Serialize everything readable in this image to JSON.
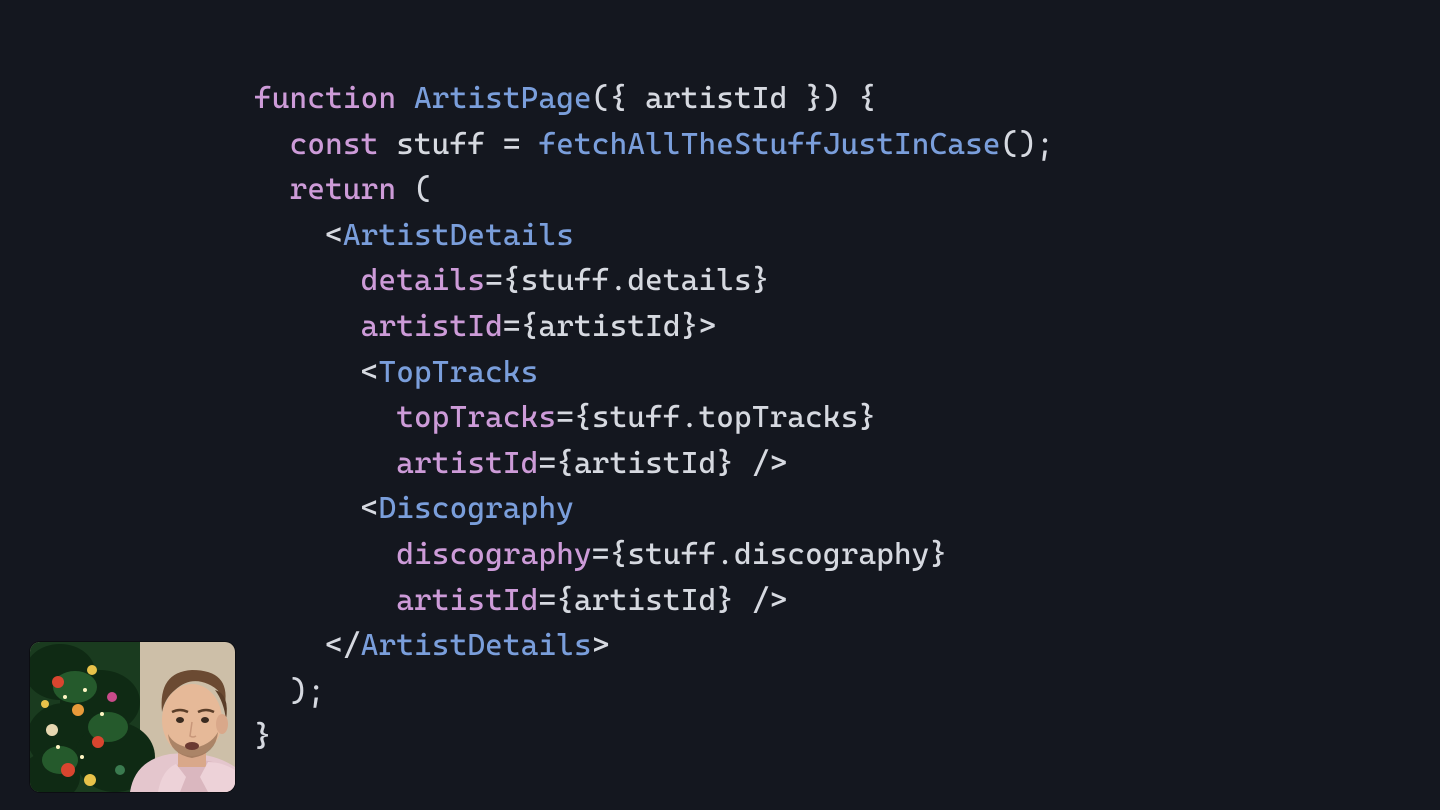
{
  "code": {
    "l1": {
      "kw_function": "function",
      "name": "ArtistPage",
      "params_open": "({ ",
      "param": "artistId",
      "params_close": " }) {"
    },
    "l2": {
      "indent": "  ",
      "kw_const": "const",
      "space": " ",
      "var": "stuff",
      "eq": " = ",
      "call": "fetchAllTheStuffJustInCase",
      "after": "();"
    },
    "l3": {
      "indent": "  ",
      "kw_return": "return",
      "paren": " ("
    },
    "l4": {
      "indent": "    ",
      "open": "<",
      "name": "ArtistDetails"
    },
    "l5": {
      "indent": "      ",
      "attr": "details",
      "eq": "=",
      "brace_o": "{",
      "obj": "stuff",
      "dot": ".",
      "prop": "details",
      "brace_c": "}"
    },
    "l6": {
      "indent": "      ",
      "attr": "artistId",
      "eq": "=",
      "brace_o": "{",
      "val": "artistId",
      "brace_c": "}",
      "close": ">"
    },
    "l7": {
      "indent": "      ",
      "open": "<",
      "name": "TopTracks"
    },
    "l8": {
      "indent": "        ",
      "attr": "topTracks",
      "eq": "=",
      "brace_o": "{",
      "obj": "stuff",
      "dot": ".",
      "prop": "topTracks",
      "brace_c": "}"
    },
    "l9": {
      "indent": "        ",
      "attr": "artistId",
      "eq": "=",
      "brace_o": "{",
      "val": "artistId",
      "brace_c": "}",
      "close": " />"
    },
    "l10": {
      "indent": "      ",
      "open": "<",
      "name": "Discography"
    },
    "l11": {
      "indent": "        ",
      "attr": "discography",
      "eq": "=",
      "brace_o": "{",
      "obj": "stuff",
      "dot": ".",
      "prop": "discography",
      "brace_c": "}"
    },
    "l12": {
      "indent": "        ",
      "attr": "artistId",
      "eq": "=",
      "brace_o": "{",
      "val": "artistId",
      "brace_c": "}",
      "close": " />"
    },
    "l13": {
      "indent": "    ",
      "open": "</",
      "name": "ArtistDetails",
      "close": ">"
    },
    "l14": {
      "indent": "  ",
      "text": ");"
    },
    "l15": {
      "text": "}"
    }
  }
}
